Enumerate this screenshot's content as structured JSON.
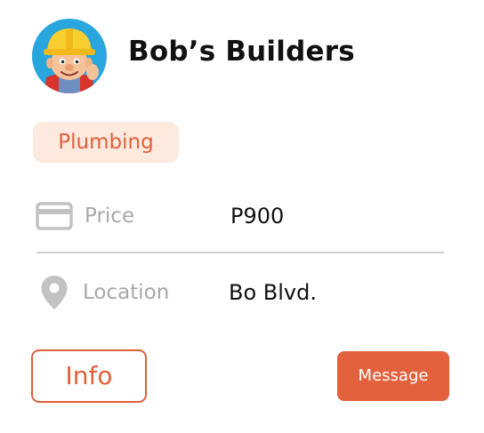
{
  "business": {
    "name": "Bob’s Builders",
    "avatar_icon": "builder-character-avatar"
  },
  "category": {
    "label": "Plumbing"
  },
  "details": {
    "price": {
      "icon": "credit-card-icon",
      "label": "Price",
      "value": "P900"
    },
    "location": {
      "icon": "map-pin-icon",
      "label": "Location",
      "value": "Bo Blvd."
    }
  },
  "actions": {
    "info_label": "Info",
    "message_label": "Message"
  },
  "colors": {
    "accent": "#e4613d",
    "tag_background": "#fde9de",
    "muted_text": "#a8a8a8",
    "divider": "#cfcfcf"
  }
}
